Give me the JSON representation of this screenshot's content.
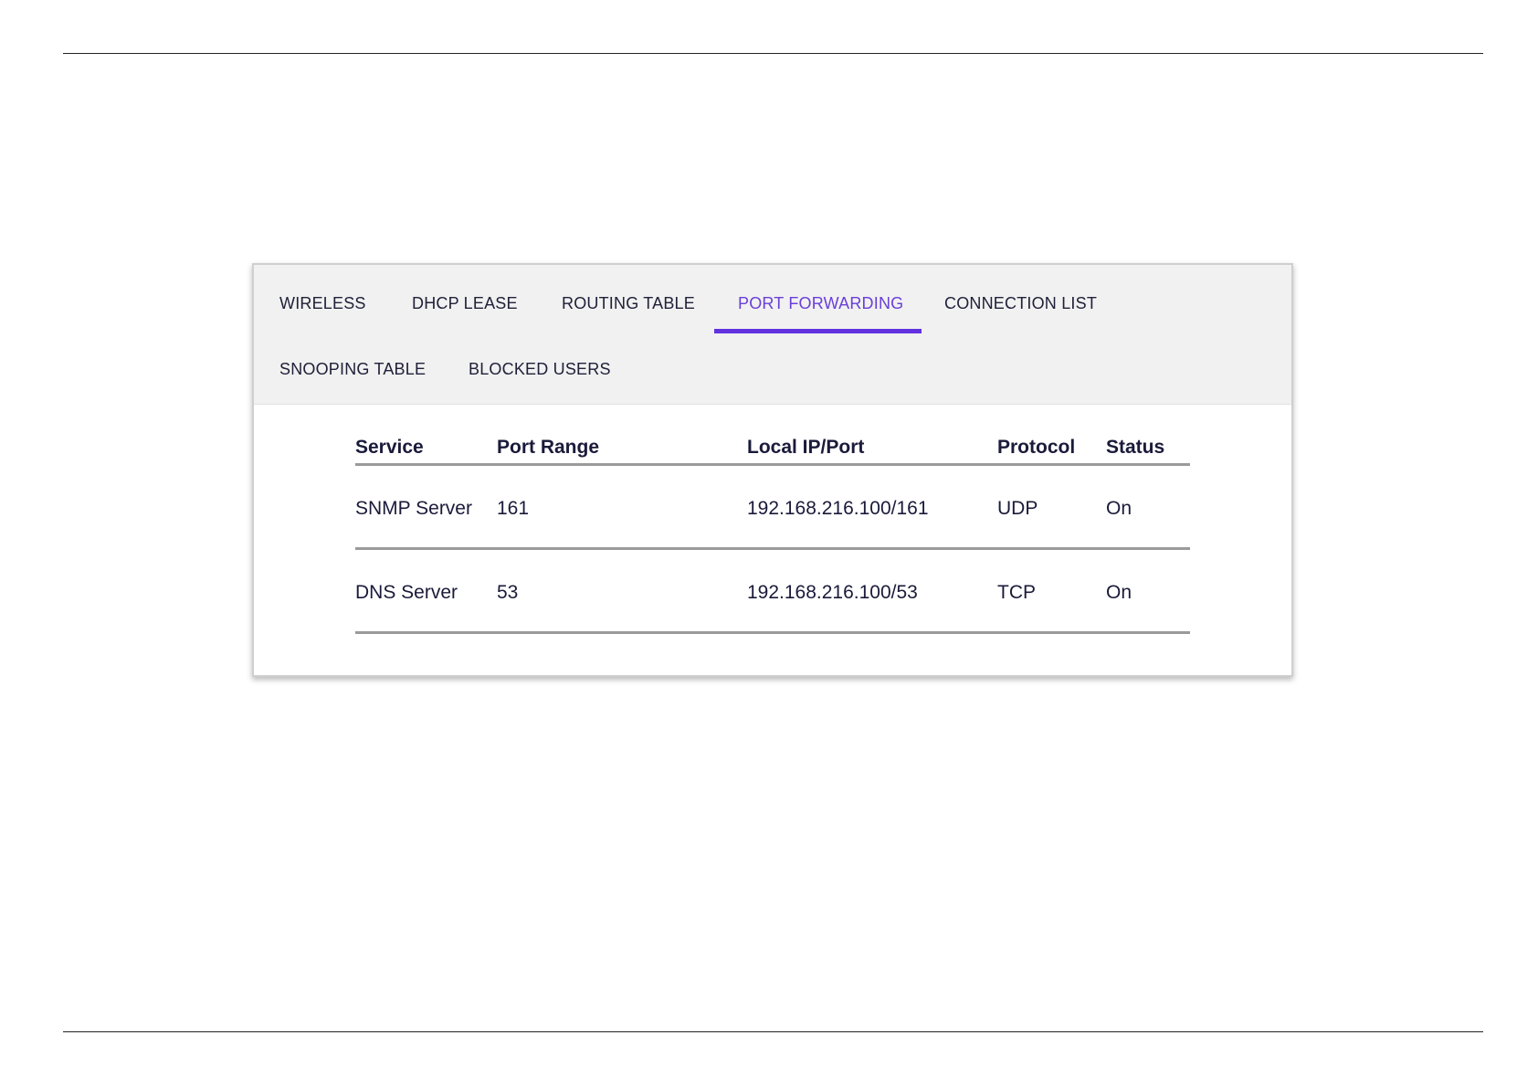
{
  "tabs": [
    {
      "label": "WIRELESS",
      "active": false
    },
    {
      "label": "DHCP LEASE",
      "active": false
    },
    {
      "label": "ROUTING TABLE",
      "active": false
    },
    {
      "label": "PORT FORWARDING",
      "active": true
    },
    {
      "label": "CONNECTION LIST",
      "active": false
    },
    {
      "label": "SNOOPING TABLE",
      "active": false
    },
    {
      "label": "BLOCKED USERS",
      "active": false
    }
  ],
  "accent_color": "#6232e0",
  "table": {
    "headers": [
      "Service",
      "Port Range",
      "Local IP/Port",
      "Protocol",
      "Status"
    ],
    "rows": [
      [
        "SNMP Server",
        "161",
        "192.168.216.100/161",
        "UDP",
        "On"
      ],
      [
        "DNS Server",
        "53",
        "192.168.216.100/53",
        "TCP",
        "On"
      ]
    ]
  }
}
